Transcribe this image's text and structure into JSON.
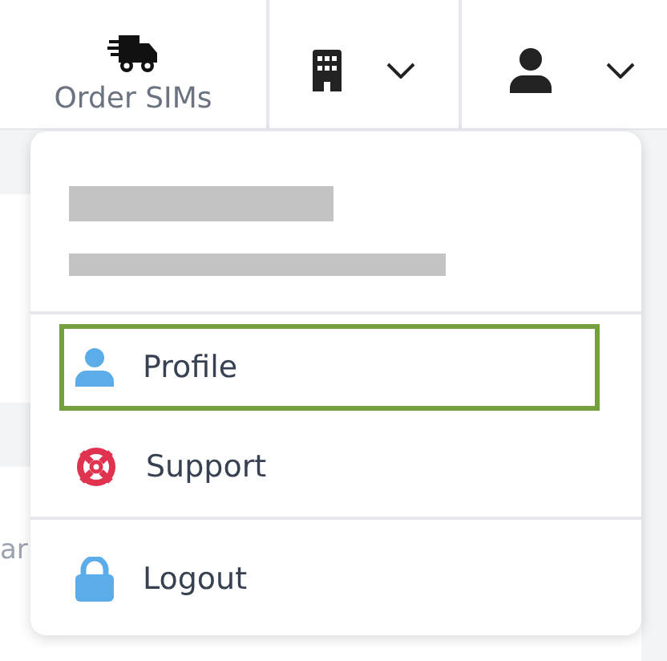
{
  "top_bar": {
    "order_button": {
      "label": "Order SIMs"
    }
  },
  "background": {
    "partial_text": "ar"
  },
  "user_menu": {
    "items": [
      {
        "label": "Profile",
        "selected": true,
        "divider_before": false
      },
      {
        "label": "Support",
        "selected": false,
        "divider_before": false
      },
      {
        "label": "Logout",
        "selected": false,
        "divider_before": true
      }
    ]
  }
}
